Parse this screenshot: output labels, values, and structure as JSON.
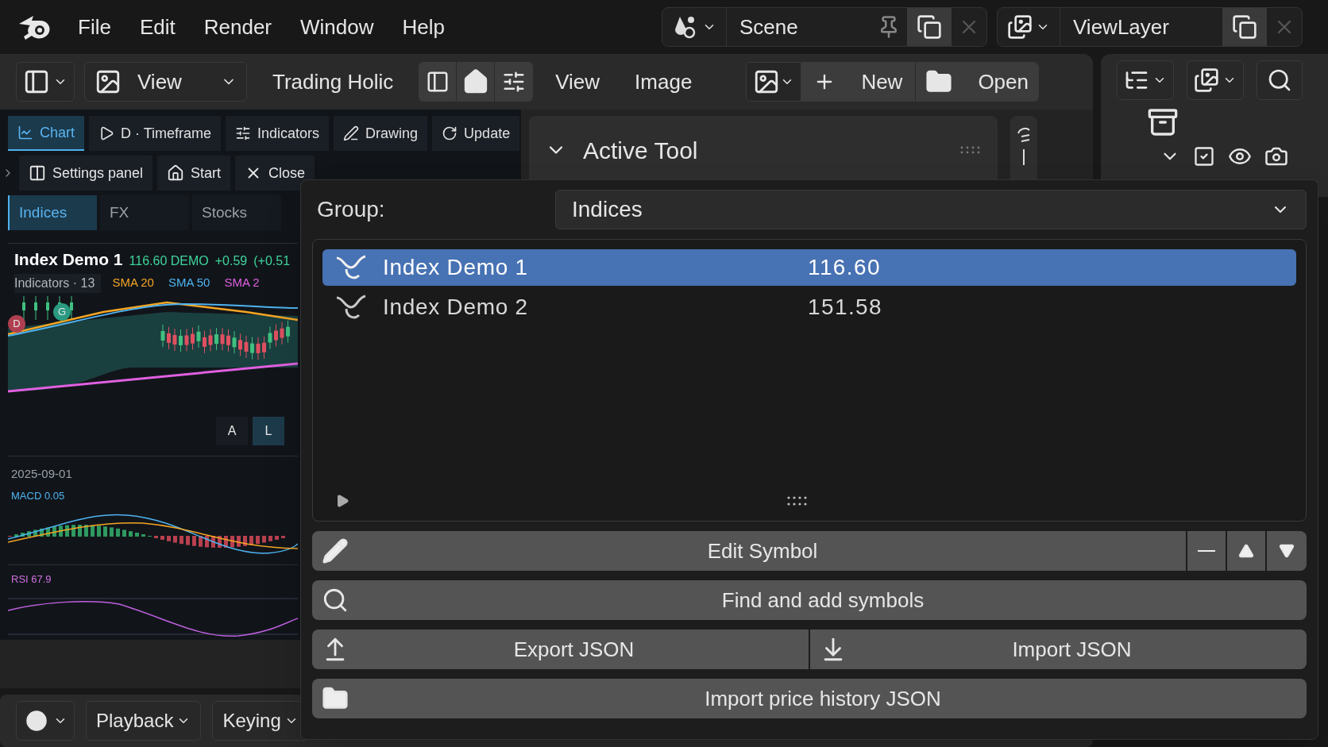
{
  "menu_bar": {
    "items": [
      "File",
      "Edit",
      "Render",
      "Window",
      "Help"
    ],
    "scene": "Scene",
    "view_layer": "ViewLayer"
  },
  "editor_header": {
    "view_dropdown": "View",
    "title": "Trading Holic",
    "menus": [
      "View",
      "Image"
    ],
    "new_button": "New",
    "open_button": "Open"
  },
  "sidebar": {
    "toolbar": [
      {
        "label": "Chart",
        "selected": true
      },
      {
        "label": "D · Timeframe",
        "selected": false
      },
      {
        "label": "Indicators",
        "selected": false
      },
      {
        "label": "Drawing",
        "selected": false
      },
      {
        "label": "Update",
        "selected": false
      }
    ],
    "actions": [
      "Settings panel",
      "Start",
      "Close"
    ],
    "group_tabs": [
      {
        "label": "Indices",
        "selected": true
      },
      {
        "label": "FX",
        "selected": false
      },
      {
        "label": "Stocks",
        "selected": false
      }
    ],
    "chart": {
      "symbol": "Index Demo 1",
      "price": "116.60 DEMO",
      "change": "+0.59",
      "change_pct": "(+0.51",
      "indicators_label": "Indicators · 13",
      "overlays": [
        {
          "label": "SMA 20",
          "color": "#f5a623"
        },
        {
          "label": "SMA 50",
          "color": "#4fb3f0"
        },
        {
          "label": "SMA 2",
          "color": "#e060e0"
        }
      ],
      "markers": [
        "D",
        "G"
      ],
      "scale_buttons": [
        {
          "label": "A",
          "selected": false
        },
        {
          "label": "L",
          "selected": true
        }
      ],
      "date": "2025-09-01",
      "macd_label": "MACD 0.05",
      "rsi_label": "RSI 67.9"
    }
  },
  "active_tool": {
    "title": "Active Tool"
  },
  "timeline": {
    "menus": [
      "Playback",
      "Keying"
    ]
  },
  "popup": {
    "group_label": "Group:",
    "group_value": "Indices",
    "symbols": [
      {
        "name": "Index Demo 1",
        "price": "116.60",
        "selected": true
      },
      {
        "name": "Index Demo 2",
        "price": "151.58",
        "selected": false
      }
    ],
    "edit_button": "Edit Symbol",
    "find_button": "Find and add symbols",
    "export_button": "Export JSON",
    "import_button": "Import JSON",
    "history_button": "Import price history JSON"
  }
}
